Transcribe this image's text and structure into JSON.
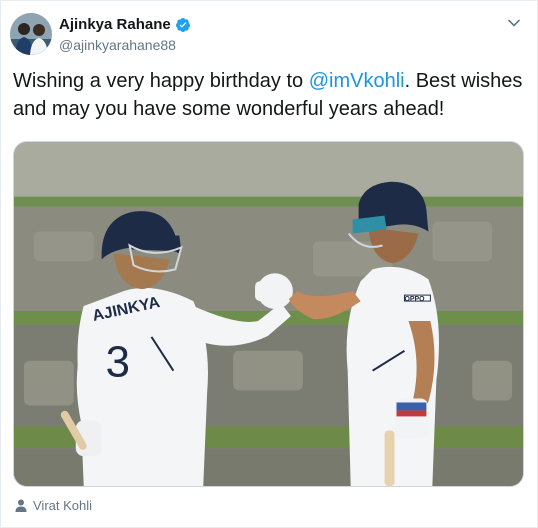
{
  "tweet": {
    "author": {
      "display_name": "Ajinkya Rahane",
      "handle": "@ajinkyarahane88",
      "verified_icon": "verified-badge-icon"
    },
    "text": {
      "before_mention": "Wishing a very happy birthday to ",
      "mention": "@imVkohli",
      "after_mention": ". Best wishes and may you have some wonderful years ahead!"
    },
    "media": {
      "jersey_name": "AJINKYA",
      "jersey_number": "3",
      "sponsor": "OPPO"
    },
    "tagged_person": "Virat Kohli"
  },
  "colors": {
    "accent": "#1b95e0",
    "verified": "#1da1f2",
    "secondary_text": "#657786",
    "primary_text": "#14171a"
  }
}
